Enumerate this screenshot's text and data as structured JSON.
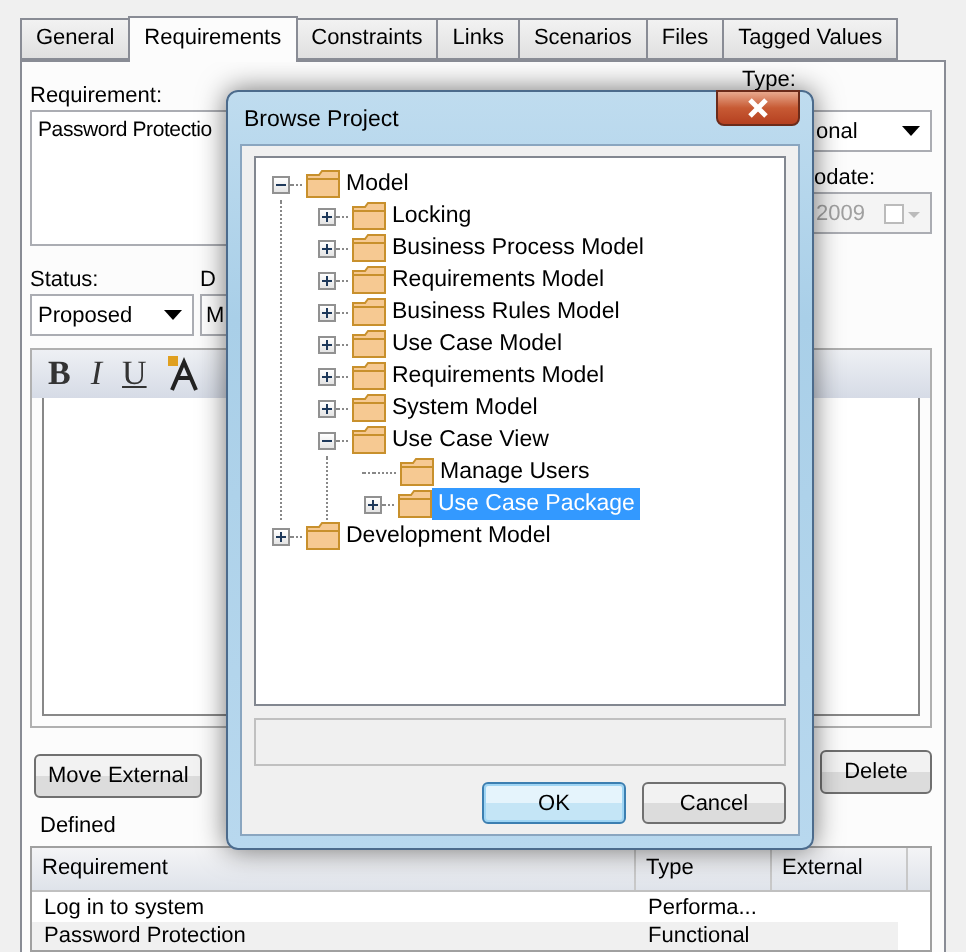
{
  "tabs": [
    {
      "label": "General",
      "selected": false
    },
    {
      "label": "Requirements",
      "selected": true
    },
    {
      "label": "Constraints",
      "selected": false
    },
    {
      "label": "Links",
      "selected": false
    },
    {
      "label": "Scenarios",
      "selected": false
    },
    {
      "label": "Files",
      "selected": false
    },
    {
      "label": "Tagged Values",
      "selected": false
    }
  ],
  "requirement": {
    "label": "Requirement:",
    "value": "Password Protectio"
  },
  "type": {
    "label": "Type:",
    "value": "onal"
  },
  "last_update": {
    "label": "odate:",
    "value": "2009"
  },
  "status": {
    "label": "Status:",
    "value": "Proposed"
  },
  "difficulty": {
    "label": "D",
    "value": "M"
  },
  "editor_toolbar": [
    "B",
    "I",
    "U"
  ],
  "move_external_button": "Move External",
  "delete_button": "Delete",
  "defined_label": "Defined",
  "table": {
    "columns": [
      "Requirement",
      "Type",
      "External"
    ],
    "rows": [
      {
        "cells": [
          "Log in to system",
          "Performa...",
          ""
        ]
      },
      {
        "cells": [
          "Password Protection",
          "Functional",
          ""
        ]
      }
    ]
  },
  "dialog": {
    "title": "Browse Project",
    "tree": [
      {
        "label": "Model",
        "expanded": true,
        "selected": false,
        "children": [
          {
            "label": "Locking",
            "expanded": false,
            "selected": false
          },
          {
            "label": "Business Process Model",
            "expanded": false,
            "selected": false
          },
          {
            "label": "Requirements Model",
            "expanded": false,
            "selected": false
          },
          {
            "label": "Business Rules Model",
            "expanded": false,
            "selected": false
          },
          {
            "label": "Use Case Model",
            "expanded": false,
            "selected": false
          },
          {
            "label": "Requirements Model",
            "expanded": false,
            "selected": false
          },
          {
            "label": "System Model",
            "expanded": false,
            "selected": false
          },
          {
            "label": "Use Case View",
            "expanded": true,
            "selected": false,
            "children": [
              {
                "label": "Manage Users",
                "selected": false
              },
              {
                "label": "Use Case Package",
                "expanded": false,
                "selected": true
              }
            ]
          }
        ]
      },
      {
        "label": "Development Model",
        "expanded": false,
        "selected": false
      }
    ],
    "buttons": [
      {
        "label": "OK",
        "default": true
      },
      {
        "label": "Cancel",
        "default": false
      }
    ]
  }
}
